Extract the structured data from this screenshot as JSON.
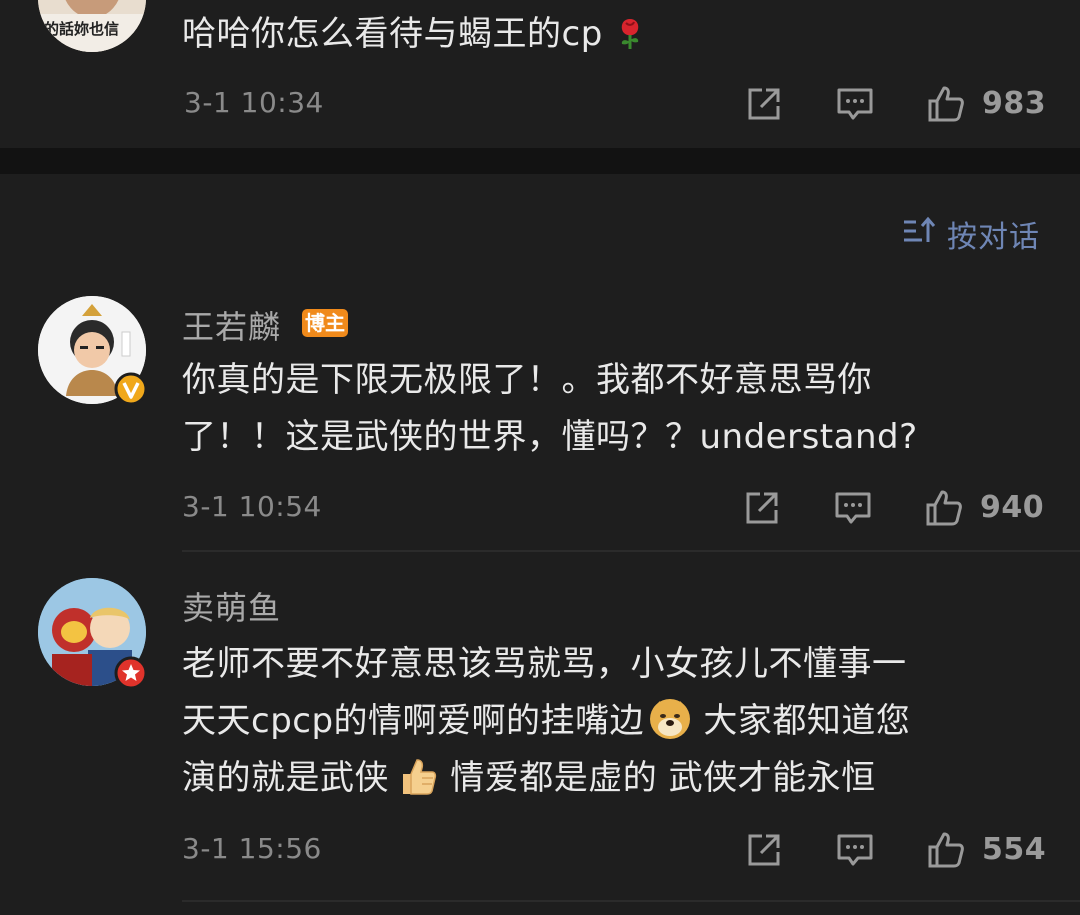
{
  "comments": [
    {
      "avatar_text": "的話妳也信",
      "text": "哈哈你怎么看待与蝎王的cp",
      "time": "3-1 10:34",
      "likes": "983"
    },
    {
      "username": "王若麟",
      "badge": "博主",
      "line1": "你真的是下限无极限了！。我都不好意思骂你",
      "line2": "了！！这是武侠的世界，懂吗？？understand?",
      "time": "3-1 10:54",
      "likes": "940"
    },
    {
      "username": "卖萌鱼",
      "line1": "老师不要不好意思该骂就骂，小女孩儿不懂事一",
      "line2a": "天天cpcp的情啊爱啊的挂嘴边",
      "line2b": " 大家都知道您",
      "line3a": "演的就是武侠",
      "line3b": " 情爱都是虚的 武侠才能永恒",
      "time": "3-1 15:56",
      "likes": "554"
    }
  ],
  "sort": {
    "label": "按对话"
  },
  "icons": [
    "share-icon",
    "comment-icon",
    "like-icon",
    "rose-icon",
    "doge-icon",
    "thumbs-up-icon",
    "verified-icon",
    "sort-icon"
  ],
  "colors": {
    "background": "#1e1e1e",
    "badge": "#f08a1b",
    "sort_link": "#6f86b5",
    "verified": "#f0a81b"
  }
}
